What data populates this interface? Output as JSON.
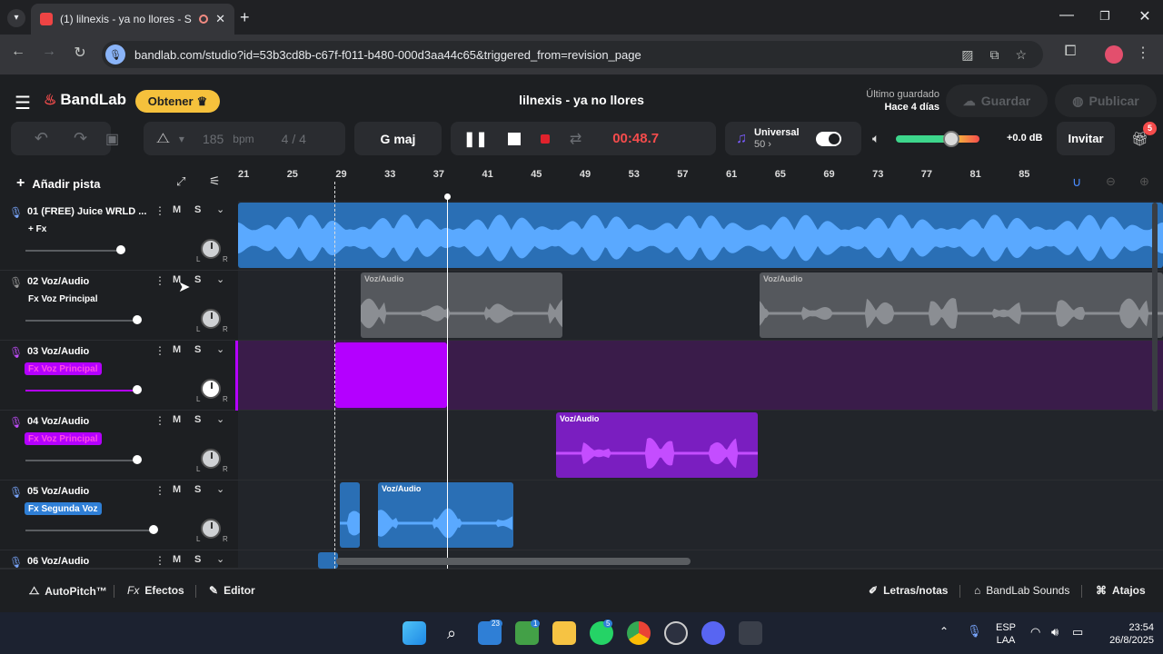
{
  "browser": {
    "tab_title": "(1) lilnexis - ya no llores - S",
    "url": "bandlab.com/studio?id=53b3cd8b-c67f-f011-b480-000d3aa44c65&triggered_from=revision_page"
  },
  "app": {
    "logo": "BandLab",
    "obtener": "Obtener",
    "song_title": "lilnexis - ya no llores",
    "saved_label": "Último guardado",
    "saved_time": "Hace 4 días",
    "save_button": "Guardar",
    "publish_button": "Publicar"
  },
  "transport": {
    "bpm_value": "185",
    "bpm_unit": "bpm",
    "time_signature": "4 / 4",
    "key": "G maj",
    "time": "00:48.7",
    "universal_label": "Universal",
    "universal_value": "50",
    "volume_db": "+0.0 dB",
    "invite": "Invitar",
    "gift_badge": "5",
    "accent_color": "#f54c4c"
  },
  "timeline": {
    "add_track": "Añadir pista",
    "ruler_ticks": [
      "21",
      "25",
      "29",
      "33",
      "37",
      "41",
      "45",
      "49",
      "53",
      "57",
      "61",
      "65",
      "69",
      "73",
      "77",
      "81",
      "85"
    ]
  },
  "tracks": [
    {
      "name": "01  (FREE) Juice WRLD ...",
      "fx": "+ Fx",
      "color": "#3b8fe0"
    },
    {
      "name": "02  Voz/Audio",
      "fx": "Fx Voz Principal",
      "color": "#8a8d92"
    },
    {
      "name": "03  Voz/Audio",
      "fx": "Fx Voz Principal",
      "color": "#b400ff"
    },
    {
      "name": "04  Voz/Audio",
      "fx": "Fx Voz Principal",
      "color": "#b400ff"
    },
    {
      "name": "05  Voz/Audio",
      "fx": "Fx Segunda Voz",
      "color": "#3b8fe0"
    },
    {
      "name": "06  Voz/Audio",
      "fx": "",
      "color": "#3b8fe0"
    }
  ],
  "clips": {
    "label": "Voz/Audio"
  },
  "mute_label": "M",
  "solo_label": "S",
  "bottom": {
    "autopitch": "AutoPitch™",
    "efectos": "Efectos",
    "editor": "Editor",
    "letras": "Letras/notas",
    "sounds": "BandLab Sounds",
    "atajos": "Atajos"
  },
  "taskbar": {
    "lang": "ESP",
    "region": "LAA",
    "clock_time": "23:54",
    "clock_date": "26/8/2025",
    "badge_a": "23",
    "badge_b": "1",
    "badge_c": "5"
  }
}
